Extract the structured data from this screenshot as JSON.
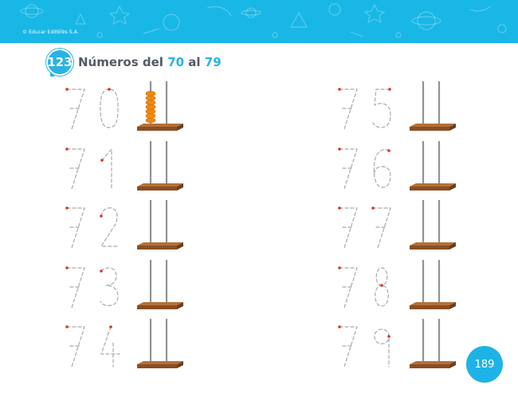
{
  "banner": {
    "copyright": "© Educar Editores S.A.",
    "color": "#19b7e6"
  },
  "header": {
    "badge": "123",
    "title_prefix": "Números del",
    "range_start": "70",
    "connector": "al",
    "range_end": "79"
  },
  "colors": {
    "accent": "#29b3e5",
    "trace_dash": "#a9a9a9",
    "start_dot": "#e0302a",
    "bead": "#f2890e",
    "base_top": "#b4703a",
    "base_front": "#8a4e22",
    "rod": "#8f9396"
  },
  "exercises": [
    {
      "number": "70",
      "tens": 7,
      "units": 0
    },
    {
      "number": "71",
      "tens": 7,
      "units": 1
    },
    {
      "number": "72",
      "tens": 7,
      "units": 2
    },
    {
      "number": "73",
      "tens": 7,
      "units": 3
    },
    {
      "number": "74",
      "tens": 7,
      "units": 4
    },
    {
      "number": "75",
      "tens": 7,
      "units": 5
    },
    {
      "number": "76",
      "tens": 7,
      "units": 6
    },
    {
      "number": "77",
      "tens": 7,
      "units": 7
    },
    {
      "number": "78",
      "tens": 7,
      "units": 8
    },
    {
      "number": "79",
      "tens": 7,
      "units": 9
    }
  ],
  "abacus_beads": {
    "rod": "tens",
    "count": 7,
    "shown_on": "70"
  },
  "page_number": "189"
}
